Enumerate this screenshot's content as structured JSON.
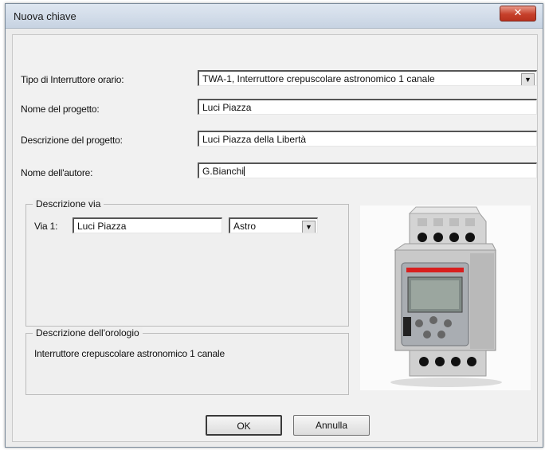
{
  "window": {
    "title": "Nuova chiave",
    "close_label": "✕"
  },
  "form": {
    "tipo_label": "Tipo di Interruttore orario:",
    "tipo_value": "TWA-1, Interruttore crepuscolare astronomico 1 canale",
    "nome_progetto_label": "Nome del progetto:",
    "nome_progetto_value": "Luci Piazza",
    "descrizione_progetto_label": "Descrizione del progetto:",
    "descrizione_progetto_value": "Luci Piazza della Libertà",
    "nome_autore_label": "Nome dell'autore:",
    "nome_autore_value": "G.Bianchi"
  },
  "descrizione_via": {
    "title": "Descrizione via",
    "via_label": "Via 1:",
    "via_value": "Luci Piazza",
    "mode_value": "Astro"
  },
  "descrizione_orologio": {
    "title": "Descrizione dell'orologio",
    "text": "Interruttore crepuscolare astronomico 1 canale"
  },
  "buttons": {
    "ok": "OK",
    "cancel": "Annulla"
  },
  "icons": {
    "dropdown": "chevron-down-icon",
    "close": "close-icon",
    "device": "din-rail-timer-device"
  },
  "colors": {
    "close_button": "#c6402b",
    "titlebar": "#d3dde9",
    "panel": "#f1f1f1",
    "device_accent": "#d81e1e"
  }
}
